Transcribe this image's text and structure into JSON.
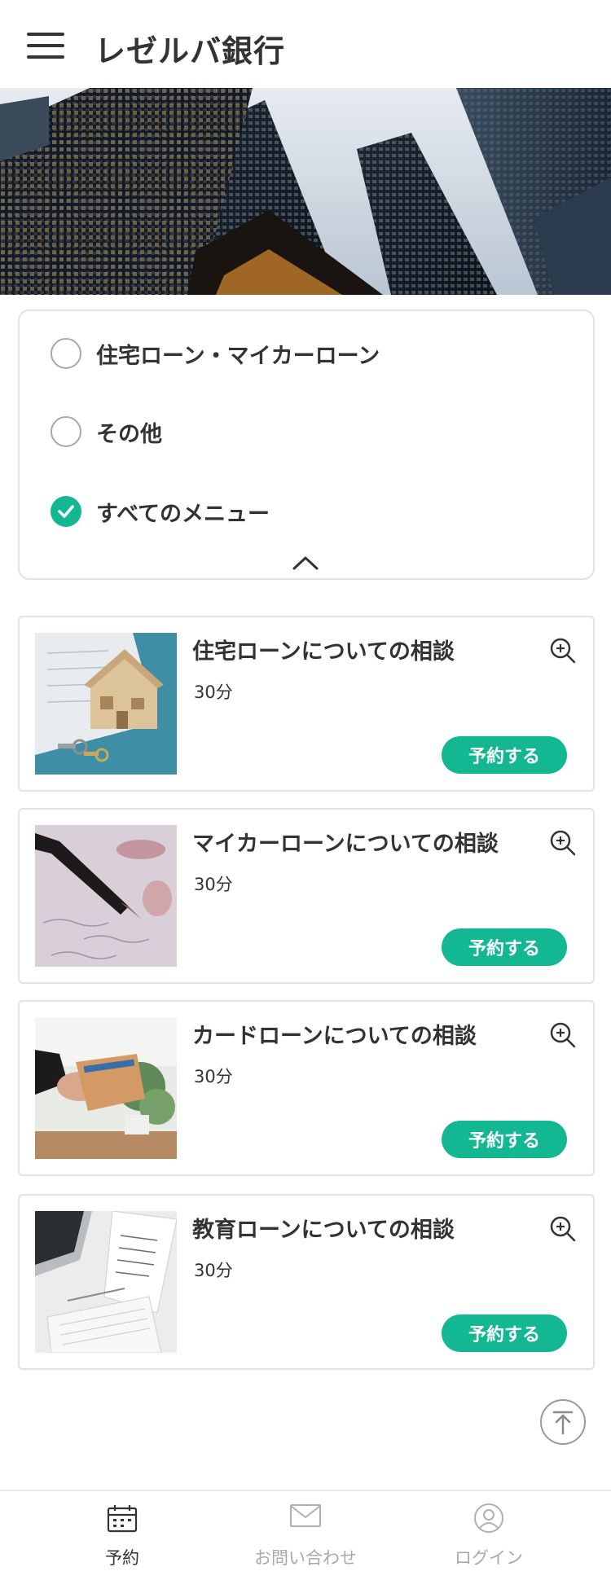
{
  "header": {
    "title": "レゼルバ銀行"
  },
  "filters": [
    {
      "label": "住宅ローン・マイカーローン",
      "checked": false
    },
    {
      "label": "その他",
      "checked": false
    },
    {
      "label": "すべてのメニュー",
      "checked": true
    }
  ],
  "cards": [
    {
      "title": "住宅ローンについての相談",
      "duration": "30分",
      "button": "予約する"
    },
    {
      "title": "マイカーローンについての相談",
      "duration": "30分",
      "button": "予約する"
    },
    {
      "title": "カードローンについての相談",
      "duration": "30分",
      "button": "予約する"
    },
    {
      "title": "教育ローンについての相談",
      "duration": "30分",
      "button": "予約する"
    }
  ],
  "bottom_nav": [
    {
      "label": "予約",
      "icon": "calendar-icon",
      "active": true
    },
    {
      "label": "お問い合わせ",
      "icon": "mail-icon",
      "active": false
    },
    {
      "label": "ログイン",
      "icon": "user-icon",
      "active": false
    }
  ],
  "colors": {
    "accent": "#13b893",
    "text": "#333333",
    "muted": "#a9a9a9",
    "border": "#e3e3e3"
  }
}
